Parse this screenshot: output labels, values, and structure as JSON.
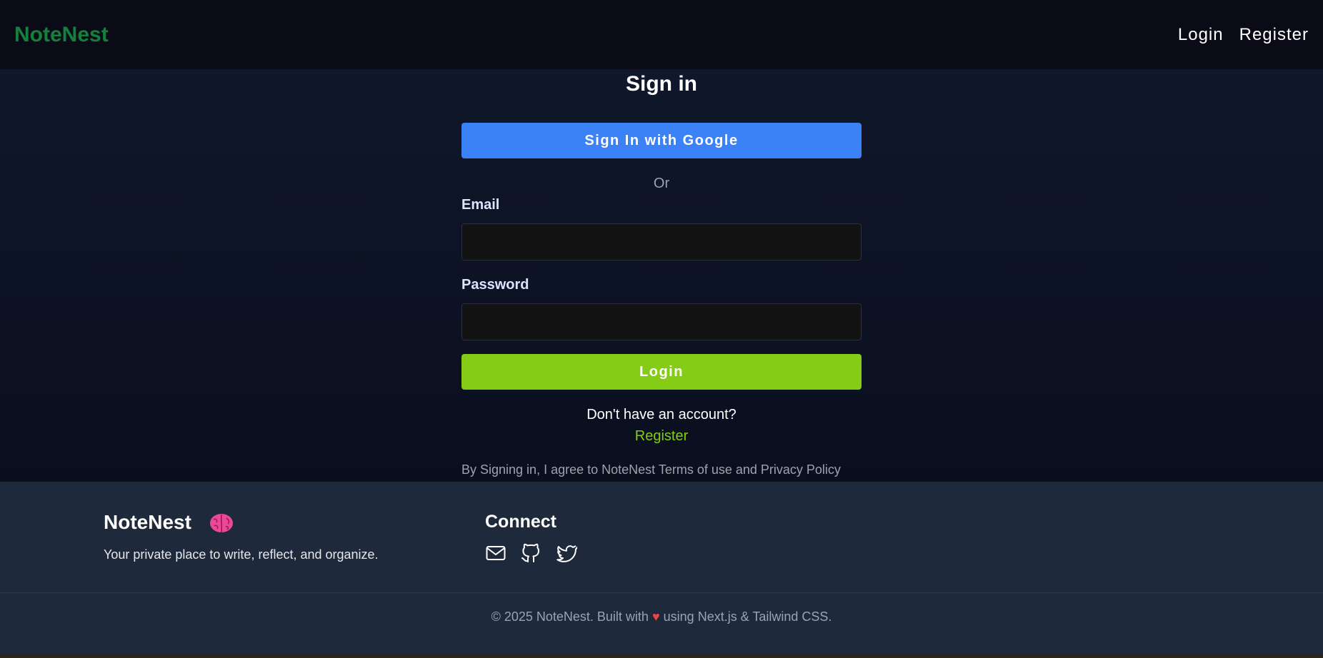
{
  "app": {
    "brand": "NoteNest"
  },
  "nav": {
    "login": "Login",
    "register": "Register"
  },
  "signin": {
    "title": "Sign in",
    "google_button": "Sign In with Google",
    "or": "Or",
    "email_label": "Email",
    "email_value": "",
    "password_label": "Password",
    "password_value": "",
    "login_button": "Login",
    "no_account": "Don't have an account?",
    "register_link": "Register",
    "terms": "By Signing in, I agree to NoteNest Terms of use and Privacy Policy"
  },
  "footer": {
    "brand": "NoteNest",
    "brand_icon": "brain-icon",
    "tagline": "Your private place to write, reflect, and organize.",
    "connect_title": "Connect",
    "connect_icons": [
      "mail-icon",
      "github-icon",
      "twitter-icon"
    ],
    "copyright_before": "© 2025 NoteNest. Built with",
    "copyright_after": "using Next.js & Tailwind CSS."
  },
  "colors": {
    "brand_green": "#15803d",
    "google_blue": "#3b82f6",
    "login_green": "#84cc16",
    "heart_red": "#ef4444"
  }
}
